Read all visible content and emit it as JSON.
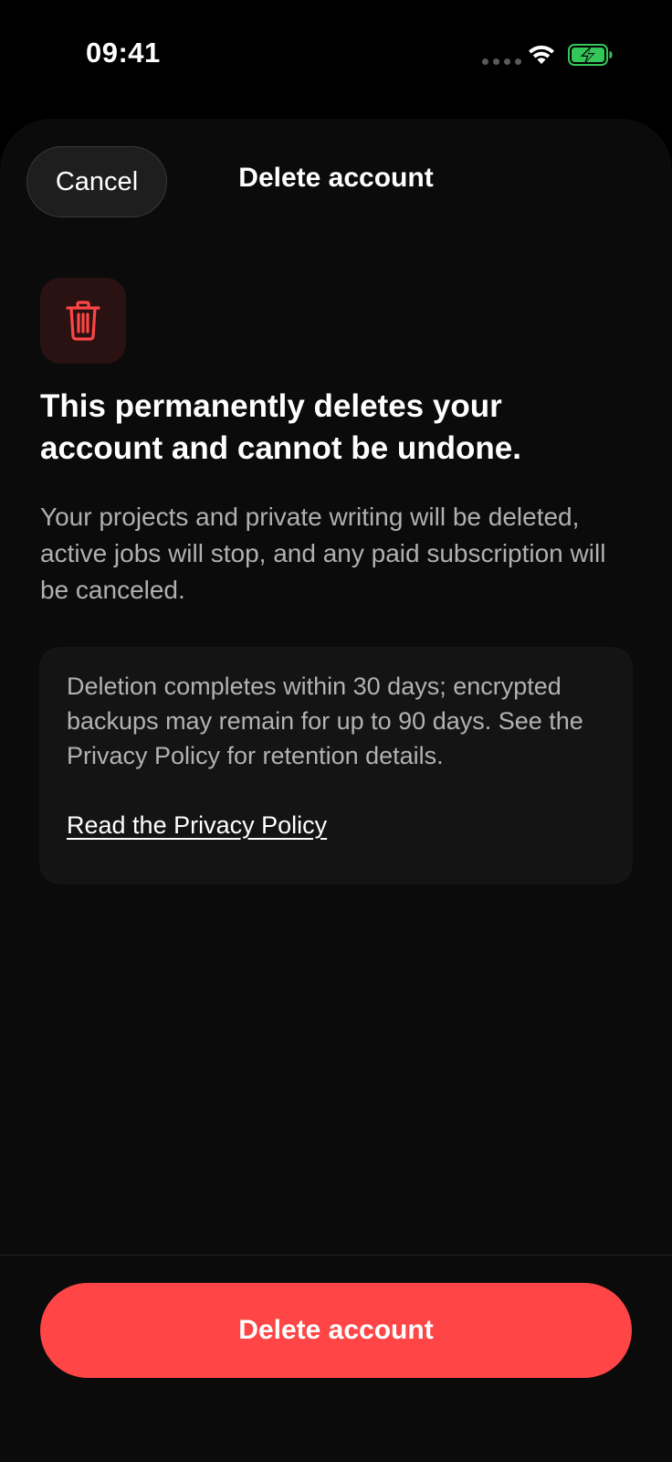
{
  "status_bar": {
    "time": "09:41",
    "icons": [
      "signal-dots",
      "wifi-icon",
      "battery-charging-icon"
    ]
  },
  "sheet": {
    "cancel_label": "Cancel",
    "title": "Delete account",
    "icon": "trash-icon",
    "headline": "This permanently deletes your account and cannot be undone.",
    "body": "Your projects and private writing will be deleted, active jobs will stop, and any paid subscription will be canceled.",
    "info_card": {
      "text": "Deletion completes within 30 days; encrypted backups may remain for up to 90 days. See the Privacy Policy for retention details.",
      "link_label": "Read the Privacy Policy"
    },
    "primary_action_label": "Delete account"
  },
  "colors": {
    "destructive": "#ff4545",
    "background": "#000000",
    "sheet_background": "#0b0b0b",
    "battery_green": "#34c759"
  }
}
